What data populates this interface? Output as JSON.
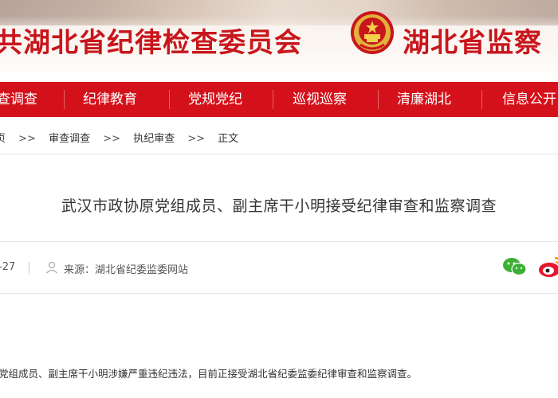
{
  "header": {
    "title_left": "共湖北省纪律检查委员会",
    "title_right": "湖北省监察",
    "emblem": "national-emblem-icon"
  },
  "nav": {
    "items": [
      {
        "label": "查调查"
      },
      {
        "label": "纪律教育"
      },
      {
        "label": "党规党纪"
      },
      {
        "label": "巡视巡察"
      },
      {
        "label": "清廉湖北"
      },
      {
        "label": "信息公开"
      }
    ]
  },
  "breadcrumb": {
    "items": [
      "页",
      "审查调查",
      "执纪审查",
      "正文"
    ],
    "separator": ">>"
  },
  "article": {
    "title": "武汉市政协原党组成员、副主席干小明接受纪律审查和监察调查",
    "date": "-27",
    "source": "来源：湖北省纪委监委网站",
    "body": "党组成员、副主席干小明涉嫌严重违纪违法，目前正接受湖北省纪委监委纪律审查和监察调查。"
  },
  "share": {
    "wechat": "wechat-icon",
    "weibo": "weibo-icon"
  },
  "colors": {
    "brand_red": "#d4111b",
    "title_red": "#c8161d",
    "text": "#333333",
    "muted": "#555555"
  }
}
